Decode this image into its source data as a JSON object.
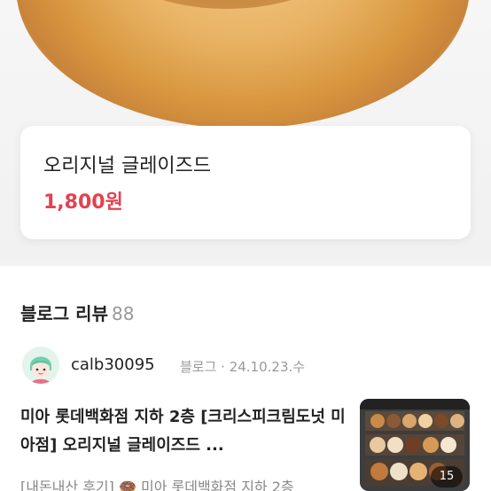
{
  "product": {
    "name": "오리지널 글레이즈드",
    "price": "1,800원"
  },
  "reviews": {
    "header_label": "블로그 리뷰",
    "count": "88",
    "items": [
      {
        "author": "calb30095",
        "meta": "블로그 · 24.10.23.수",
        "title": "미아 롯데백화점 지하 2층 [크리스피크림도넛 미아점] 오리지널 글레이즈드 ...",
        "excerpt": "[내돈내산 후기] 🍩 미아 롯데백화점 지하 2층",
        "photo_count": "15"
      }
    ]
  },
  "colors": {
    "price": "#e5404f",
    "muted": "#999999"
  }
}
